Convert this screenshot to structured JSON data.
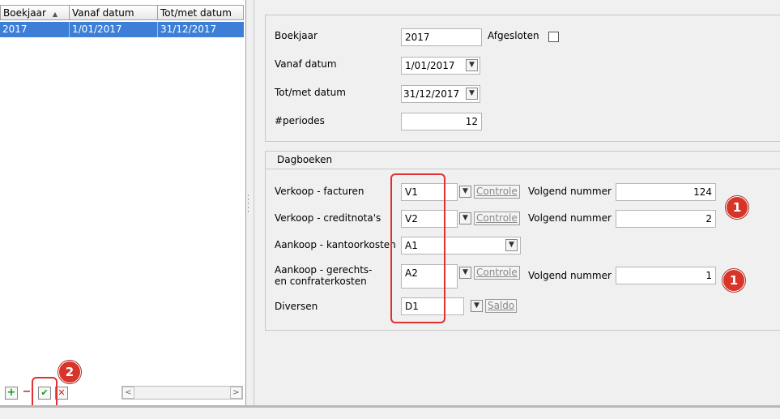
{
  "list": {
    "columns": [
      "Boekjaar",
      "Vanaf datum",
      "Tot/met datum"
    ],
    "rows": [
      {
        "boekjaar": "2017",
        "vanaf": "1/01/2017",
        "totmet": "31/12/2017"
      }
    ]
  },
  "toolbar": {
    "add_label": "+",
    "remove_label": "−",
    "confirm_label": "✔",
    "cancel_label": "✕"
  },
  "form": {
    "boekjaar_label": "Boekjaar",
    "boekjaar_value": "2017",
    "afgesloten_label": "Afgesloten",
    "vanaf_label": "Vanaf datum",
    "vanaf_value": "1/01/2017",
    "totmet_label": "Tot/met datum",
    "totmet_value": "31/12/2017",
    "periodes_label": "#periodes",
    "periodes_value": "12"
  },
  "dagboeken": {
    "title": "Dagboeken",
    "rows": [
      {
        "label": "Verkoop - facturen",
        "code": "V1",
        "action": "Controle",
        "next_label": "Volgend nummer",
        "next_value": "124"
      },
      {
        "label": "Verkoop - creditnota's",
        "code": "V2",
        "action": "Controle",
        "next_label": "Volgend nummer",
        "next_value": "2"
      },
      {
        "label": "Aankoop - kantoorkosten",
        "code": "A1"
      },
      {
        "label_line1": "Aankoop - gerechts-",
        "label_line2": "en confraterkosten",
        "code": "A2",
        "action": "Controle",
        "next_label": "Volgend nummer",
        "next_value": "1"
      },
      {
        "label": "Diversen",
        "code": "D1",
        "action": "Saldo"
      }
    ]
  },
  "markers": [
    "1",
    "1",
    "2"
  ],
  "colors": {
    "selection": "#3d7fd6",
    "marker": "#d8352a",
    "highlight": "#e03030"
  }
}
